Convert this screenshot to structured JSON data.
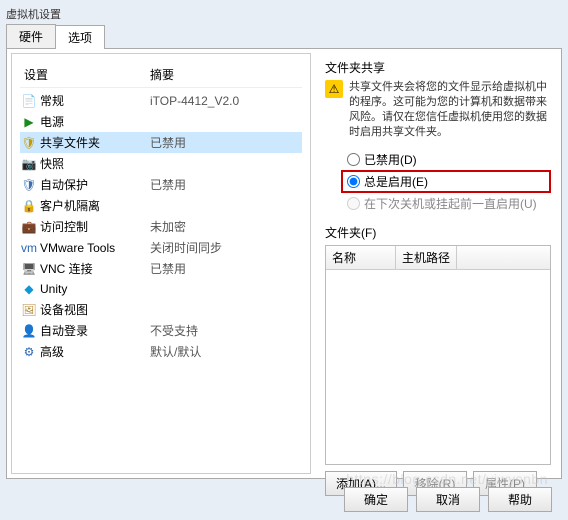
{
  "window": {
    "title": "虚拟机设置"
  },
  "tabs": {
    "hardware": "硬件",
    "options": "选项"
  },
  "settings": {
    "headers": {
      "setting": "设置",
      "summary": "摘要"
    },
    "rows": [
      {
        "icon": "📄",
        "cls": "i-gen",
        "label": "常规",
        "summary": "iTOP-4412_V2.0"
      },
      {
        "icon": "▶",
        "cls": "i-pwr",
        "label": "电源",
        "summary": ""
      },
      {
        "icon": "🛡",
        "cls": "i-sf",
        "label": "共享文件夹",
        "summary": "已禁用"
      },
      {
        "icon": "📷",
        "cls": "i-snap",
        "label": "快照",
        "summary": ""
      },
      {
        "icon": "🛡",
        "cls": "i-auto",
        "label": "自动保护",
        "summary": "已禁用"
      },
      {
        "icon": "🔒",
        "cls": "i-iso",
        "label": "客户机隔离",
        "summary": ""
      },
      {
        "icon": "💼",
        "cls": "i-acc",
        "label": "访问控制",
        "summary": "未加密"
      },
      {
        "icon": "vm",
        "cls": "i-vm",
        "label": "VMware Tools",
        "summary": "关闭时间同步"
      },
      {
        "icon": "🖥",
        "cls": "i-vnc",
        "label": "VNC 连接",
        "summary": "已禁用"
      },
      {
        "icon": "◆",
        "cls": "i-un",
        "label": "Unity",
        "summary": ""
      },
      {
        "icon": "🖼",
        "cls": "i-view",
        "label": "设备视图",
        "summary": ""
      },
      {
        "icon": "👤",
        "cls": "i-login",
        "label": "自动登录",
        "summary": "不受支持"
      },
      {
        "icon": "⚙",
        "cls": "i-adv",
        "label": "高级",
        "summary": "默认/默认"
      }
    ]
  },
  "right": {
    "sharing_label": "文件夹共享",
    "warn_icon": "⚠",
    "info_text": "共享文件夹会将您的文件显示给虚拟机中的程序。这可能为您的计算机和数据带来风险。请仅在您信任虚拟机使用您的数据时启用共享文件夹。",
    "radios": {
      "disabled": "已禁用(D)",
      "always": "总是启用(E)",
      "until": "在下次关机或挂起前一直启用(U)"
    },
    "folders_label": "文件夹(F)",
    "folders_headers": {
      "name": "名称",
      "hostpath": "主机路径"
    },
    "buttons": {
      "add": "添加(A)...",
      "remove": "移除(R)",
      "props": "属性(P)"
    }
  },
  "bottom": {
    "ok": "确定",
    "cancel": "取消",
    "help": "帮助"
  },
  "watermark": "https://blog.csdn.net/yiwysnbn"
}
